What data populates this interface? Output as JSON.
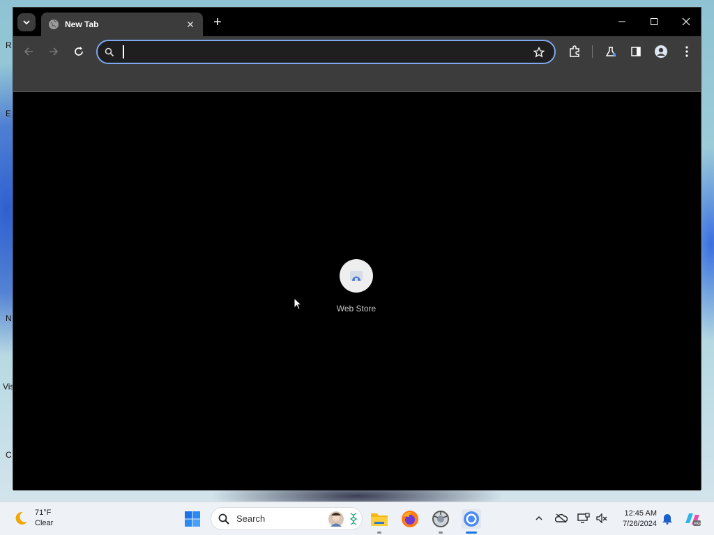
{
  "desktop": {
    "labels": [
      "R",
      "E",
      "N",
      "Vis",
      "C"
    ]
  },
  "browser": {
    "tab": {
      "title": "New Tab",
      "favicon": "globe-icon",
      "close": "✕"
    },
    "new_tab_symbol": "+",
    "omnibox": {
      "value": "",
      "placeholder": ""
    },
    "shortcut": {
      "label": "Web Store",
      "icon": "webstore-icon"
    },
    "colors": {
      "accent": "#7fa8f0",
      "toolbar": "#3c3c3c",
      "content_bg": "#000000"
    }
  },
  "taskbar": {
    "weather": {
      "temp": "71°F",
      "condition": "Clear",
      "icon": "moon-icon"
    },
    "search": {
      "label": "Search"
    },
    "clock": {
      "time": "12:45 AM",
      "date": "7/26/2024"
    },
    "apps": [
      "file-explorer-icon",
      "firefox-icon",
      "app-icon",
      "chrome-icon"
    ]
  }
}
